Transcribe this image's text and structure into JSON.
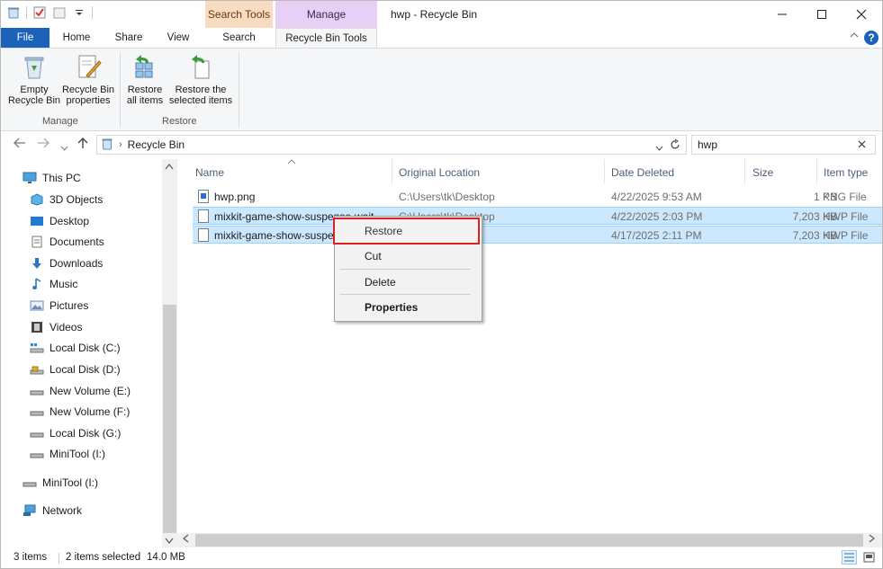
{
  "window": {
    "title": "hwp - Recycle Bin",
    "context_tab_search": "Search Tools",
    "context_tab_manage": "Manage"
  },
  "ribbon_tabs": {
    "file": "File",
    "home": "Home",
    "share": "Share",
    "view": "View",
    "search": "Search",
    "recycle_bin_tools": "Recycle Bin Tools"
  },
  "ribbon": {
    "empty_bin_line1": "Empty",
    "empty_bin_line2": "Recycle Bin",
    "properties_line1": "Recycle Bin",
    "properties_line2": "properties",
    "group_manage": "Manage",
    "restore_all_line1": "Restore",
    "restore_all_line2": "all items",
    "restore_sel_line1": "Restore the",
    "restore_sel_line2": "selected items",
    "group_restore": "Restore"
  },
  "address": {
    "location": "Recycle Bin",
    "search_value": "hwp"
  },
  "nav_pane": {
    "items": [
      {
        "label": "This PC",
        "icon": "pc-icon"
      },
      {
        "label": "3D Objects",
        "icon": "3d-objects-icon"
      },
      {
        "label": "Desktop",
        "icon": "desktop-icon"
      },
      {
        "label": "Documents",
        "icon": "documents-icon"
      },
      {
        "label": "Downloads",
        "icon": "downloads-icon"
      },
      {
        "label": "Music",
        "icon": "music-icon"
      },
      {
        "label": "Pictures",
        "icon": "pictures-icon"
      },
      {
        "label": "Videos",
        "icon": "videos-icon"
      },
      {
        "label": "Local Disk (C:)",
        "icon": "system-drive-icon"
      },
      {
        "label": "Local Disk (D:)",
        "icon": "locked-drive-icon"
      },
      {
        "label": "New Volume (E:)",
        "icon": "drive-icon"
      },
      {
        "label": "New Volume (F:)",
        "icon": "drive-icon"
      },
      {
        "label": "Local Disk (G:)",
        "icon": "drive-icon"
      },
      {
        "label": "MiniTool (I:)",
        "icon": "drive-icon"
      },
      {
        "label": "MiniTool (I:)",
        "icon": "drive-icon"
      },
      {
        "label": "Network",
        "icon": "network-icon"
      }
    ]
  },
  "columns": {
    "name": "Name",
    "original_location": "Original Location",
    "date_deleted": "Date Deleted",
    "size": "Size",
    "item_type": "Item type"
  },
  "files": [
    {
      "name": "hwp.png",
      "location": "C:\\Users\\tk\\Desktop",
      "date": "4/22/2025 9:53 AM",
      "size": "1 KB",
      "type": "PNG File"
    },
    {
      "name": "mixkit-game-show-suspense-waiti",
      "location": "C:\\Users\\tk\\Desktop",
      "date": "4/22/2025 2:03 PM",
      "size": "7,203 KB",
      "type": "HWP File"
    },
    {
      "name": "mixkit-game-show-suspe",
      "location": "",
      "date": "4/17/2025 2:11 PM",
      "size": "7,203 KB",
      "type": "HWP File"
    }
  ],
  "context_menu": {
    "restore": "Restore",
    "cut": "Cut",
    "delete": "Delete",
    "properties": "Properties"
  },
  "status": {
    "items_count": "3 items",
    "selected": "2 items selected",
    "selected_size": "14.0 MB"
  }
}
